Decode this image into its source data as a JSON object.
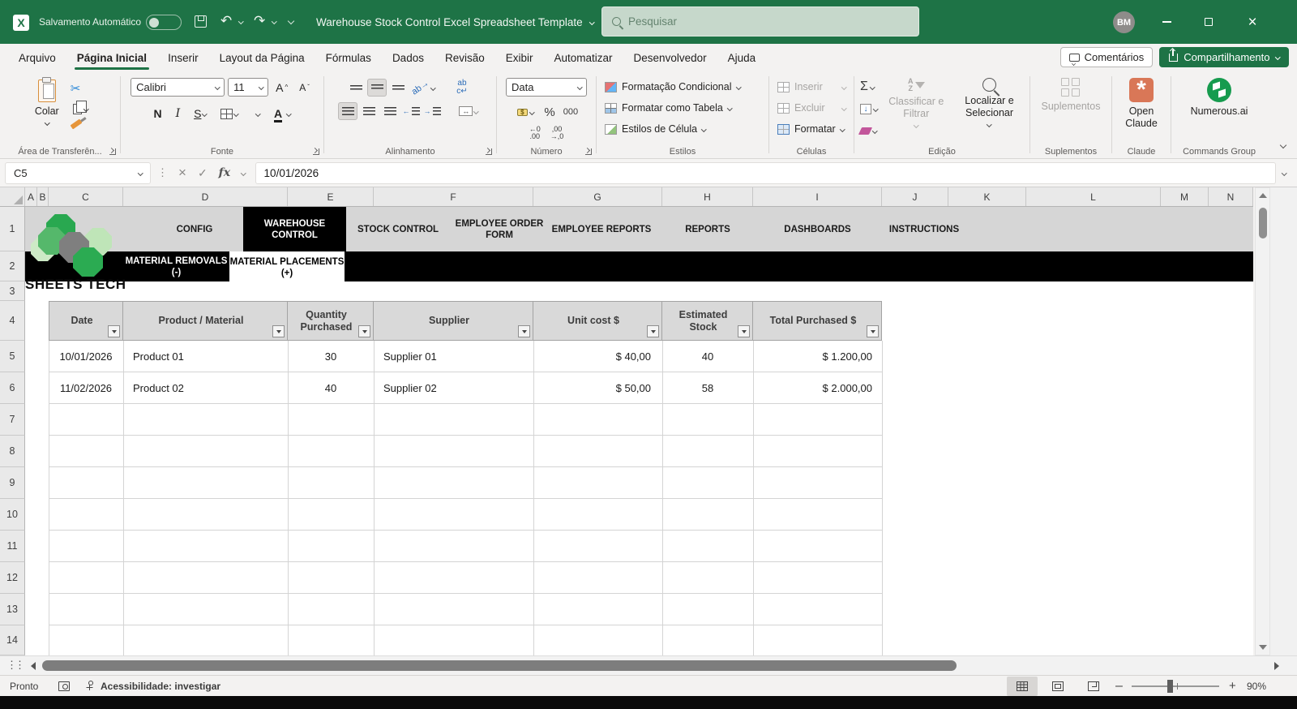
{
  "colors": {
    "titlebar_green": "#1E7346",
    "share_button_green": "#1E7346",
    "nav_band_gray": "#D6D6D6",
    "nav_black": "#000000",
    "table_header_gray": "#D9D9D9",
    "claude_orange": "#D97757",
    "numerous_green": "#169B4E"
  },
  "title_bar": {
    "autosave_label": "Salvamento Automático",
    "doc_title": "Warehouse Stock Control Excel Spreadsheet Template",
    "search_placeholder": "Pesquisar",
    "avatar_initials": "BM"
  },
  "ribbon_tabs": [
    "Arquivo",
    "Página Inicial",
    "Inserir",
    "Layout da Página",
    "Fórmulas",
    "Dados",
    "Revisão",
    "Exibir",
    "Automatizar",
    "Desenvolvedor",
    "Ajuda"
  ],
  "ribbon_right": {
    "comments": "Comentários",
    "share": "Compartilhamento"
  },
  "ribbon": {
    "clipboard": {
      "paste": "Colar",
      "label": "Área de Transferên..."
    },
    "font": {
      "name": "Calibri",
      "size": "11",
      "bold": "N",
      "italic": "I",
      "underline": "S",
      "label": "Fonte"
    },
    "alignment": {
      "wrap_top": "ab",
      "wrap_bottom": "c↵",
      "orient": "ab",
      "label": "Alinhamento"
    },
    "number": {
      "format": "Data",
      "currency": "$",
      "percent": "%",
      "thousands": "000",
      "inc_top": "←0",
      "inc_bottom": ".00",
      "dec_top": ",00",
      "dec_bottom": "→,0",
      "label": "Número"
    },
    "styles": {
      "conditional": "Formatação Condicional",
      "as_table": "Formatar como Tabela",
      "cell_styles": "Estilos de Célula",
      "label": "Estilos"
    },
    "cells": {
      "insert": "Inserir",
      "delete": "Excluir",
      "format": "Formatar",
      "label": "Células"
    },
    "editing": {
      "sum": "Σ",
      "sort": "Classificar e Filtrar",
      "find": "Localizar e Selecionar",
      "label": "Edição"
    },
    "addins": {
      "button": "Suplementos",
      "label": "Suplementos"
    },
    "claude": {
      "button": "Open Claude",
      "asterisk": "*",
      "label": "Claude"
    },
    "commands": {
      "button": "Numerous.ai",
      "label": "Commands Group"
    }
  },
  "formula_bar": {
    "name_box": "C5",
    "cancel": "×",
    "enter": "✓",
    "fx": "fx",
    "value": "10/01/2026"
  },
  "sheet": {
    "columns": [
      "A",
      "B",
      "C",
      "D",
      "E",
      "F",
      "G",
      "H",
      "I",
      "J",
      "K",
      "L",
      "M",
      "N"
    ],
    "rows": [
      "1",
      "2",
      "3",
      "4",
      "5",
      "6",
      "7",
      "8",
      "9",
      "10",
      "11",
      "12",
      "13",
      "14"
    ],
    "nav1": [
      "CONFIG",
      "WAREHOUSE CONTROL",
      "STOCK CONTROL",
      "EMPLOYEE ORDER FORM",
      "EMPLOYEE REPORTS",
      "REPORTS",
      "DASHBOARDS",
      "INSTRUCTIONS"
    ],
    "nav2": [
      "MATERIAL REMOVALS (-)",
      "MATERIAL PLACEMENTS (+)"
    ],
    "logo_text": "SHEETS TECH",
    "table": {
      "headers": [
        "Date",
        "Product / Material",
        "Quantity Purchased",
        "Supplier",
        "Unit cost $",
        "Estimated Stock",
        "Total Purchased $"
      ],
      "data": [
        [
          "10/01/2026",
          "Product 01",
          "30",
          "Supplier 01",
          "$ 40,00",
          "40",
          "$ 1.200,00"
        ],
        [
          "11/02/2026",
          "Product 02",
          "40",
          "Supplier 02",
          "$ 50,00",
          "58",
          "$ 2.000,00"
        ]
      ]
    }
  },
  "status_bar": {
    "mode": "Pronto",
    "accessibility": "Acessibilidade: investigar",
    "zoom": "90%"
  }
}
